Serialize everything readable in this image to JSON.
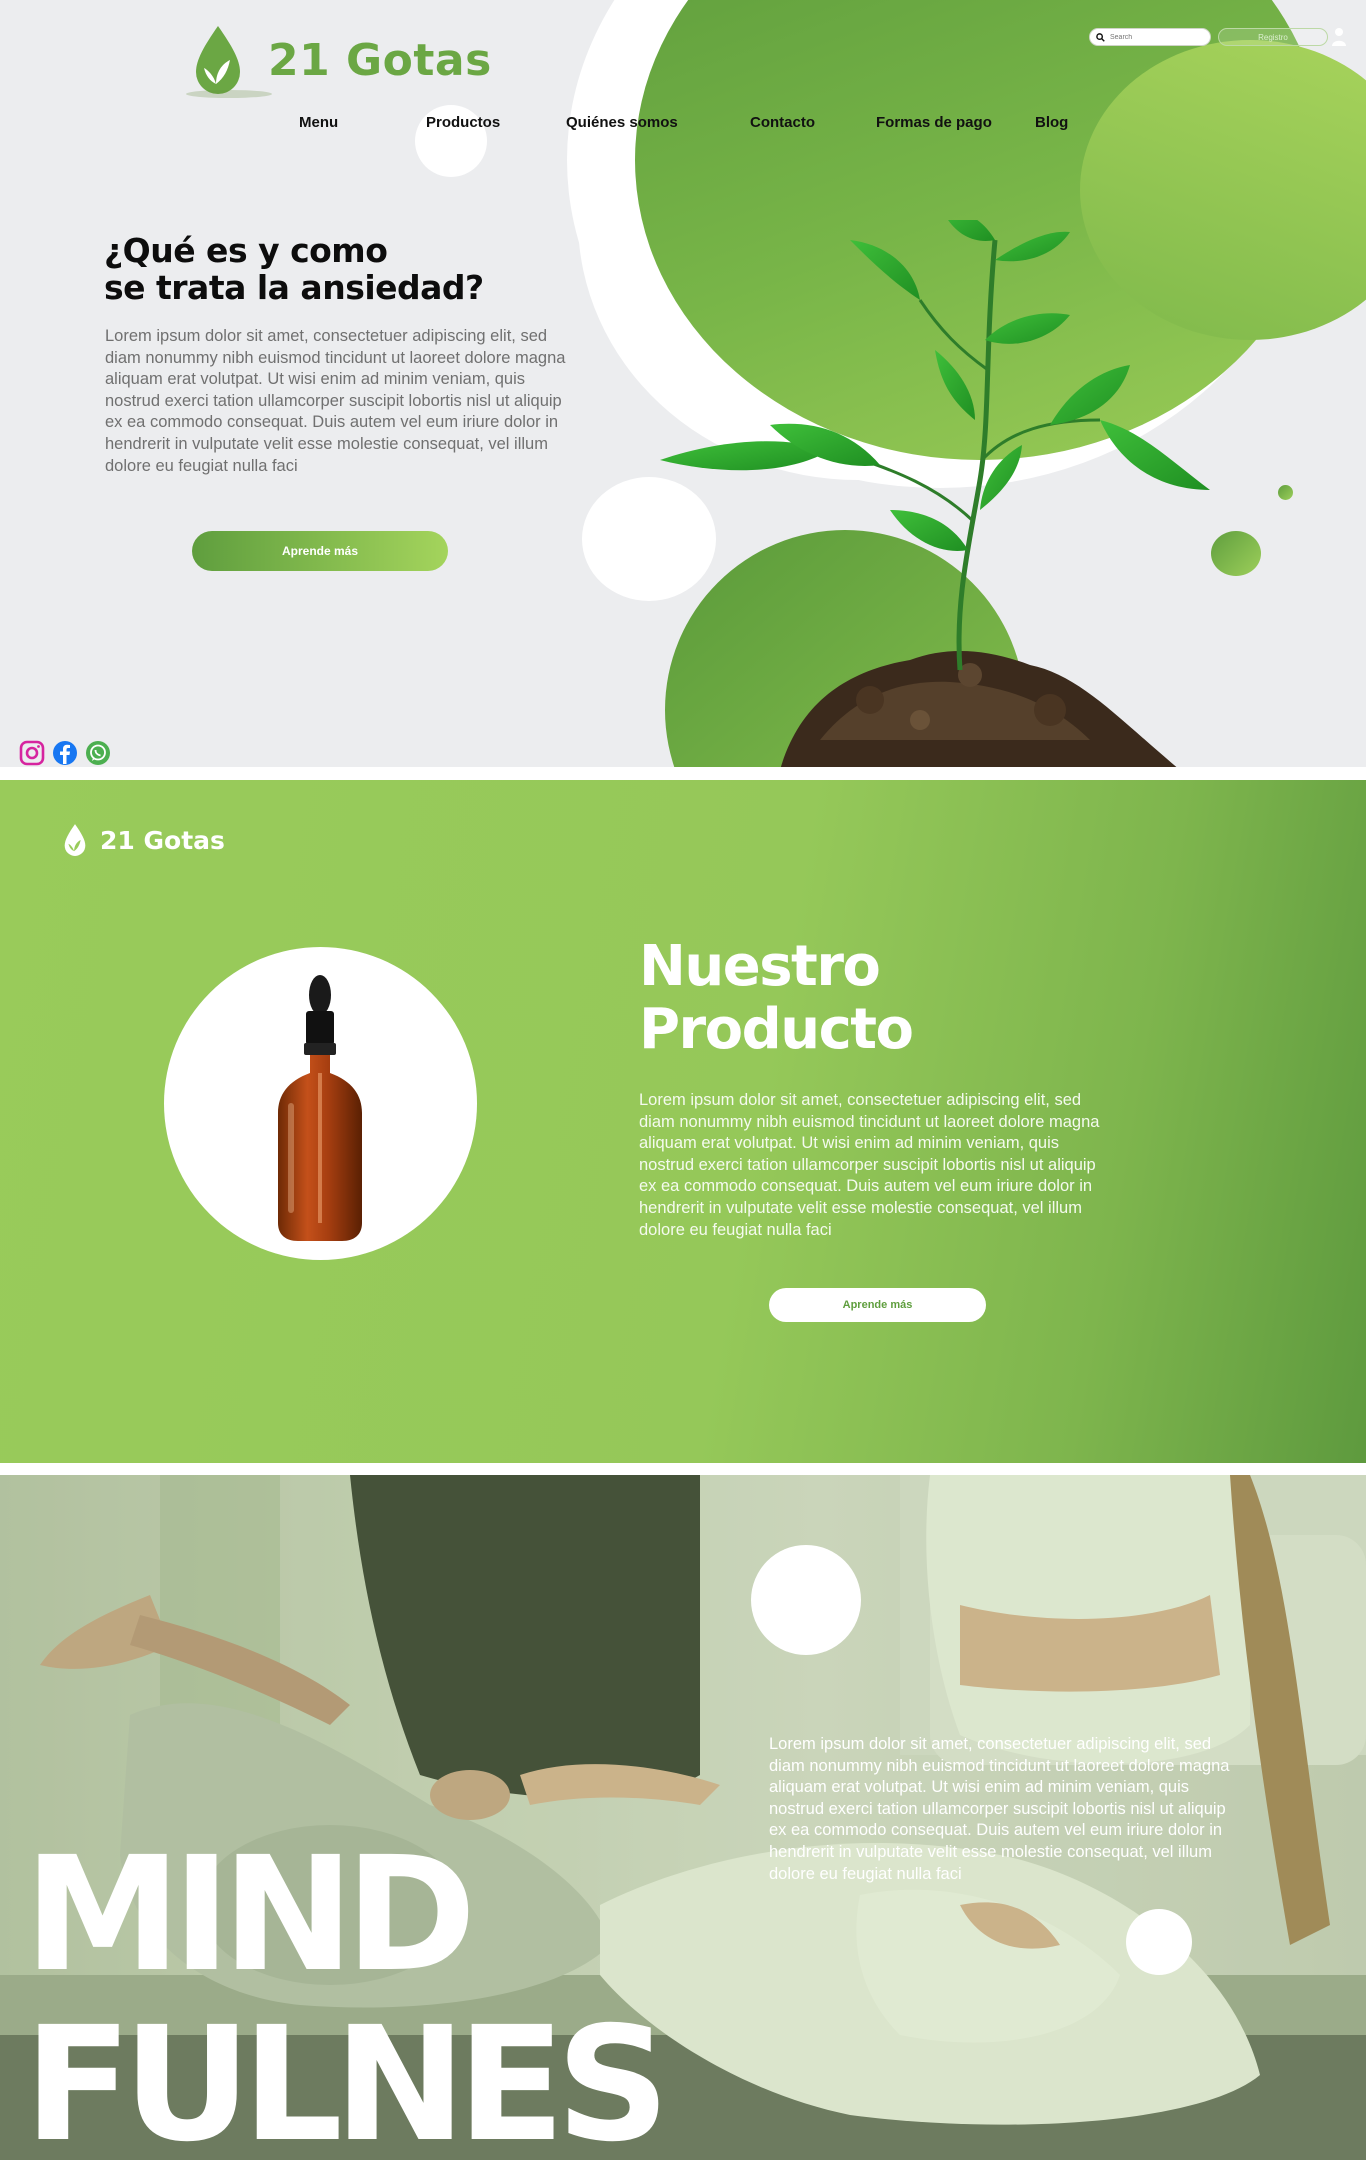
{
  "brand": {
    "name": "21 Gotas",
    "green": "#6ba744",
    "light_green": "#99cb5a",
    "dark_green": "#5e9a3e"
  },
  "header": {
    "search_placeholder": "Search",
    "registro_label": "Registro",
    "nav": [
      {
        "label": "Menu"
      },
      {
        "label": "Productos"
      },
      {
        "label": "Quiénes somos"
      },
      {
        "label": "Contacto"
      },
      {
        "label": "Formas de pago"
      },
      {
        "label": "Blog"
      }
    ]
  },
  "hero": {
    "title_line1": "¿Qué es y como",
    "title_line2": "se trata la ansiedad?",
    "body": "Lorem ipsum dolor sit amet, consectetuer adipiscing elit, sed diam nonummy nibh euismod tincidunt ut laoreet dolore magna aliquam erat volutpat. Ut wisi enim ad minim veniam, quis nostrud exerci tation ullamcorper suscipit lobortis nisl ut aliquip ex ea commodo consequat. Duis autem vel eum iriure dolor in hendrerit in vulputate velit esse molestie consequat, vel illum dolore eu feugiat nulla faci",
    "button_label": "Aprende más"
  },
  "social": [
    {
      "icon": "instagram-icon",
      "color": "#d6249f"
    },
    {
      "icon": "facebook-icon",
      "color": "#1877f2"
    },
    {
      "icon": "whatsapp-icon",
      "color": "#4caf50"
    }
  ],
  "product": {
    "title_line1": "Nuestro",
    "title_line2": "Producto",
    "body": "Lorem ipsum dolor sit amet, consectetuer adipiscing elit, sed diam nonummy nibh euismod tincidunt ut laoreet dolore magna aliquam erat volutpat. Ut wisi enim ad minim veniam, quis nostrud exerci tation ullamcorper suscipit lobortis nisl ut aliquip ex ea commodo consequat. Duis autem vel eum iriure dolor in hendrerit in vulputate velit esse molestie consequat, vel illum dolore eu feugiat nulla faci",
    "button_label": "Aprende más"
  },
  "mindfulness": {
    "body": "Lorem ipsum dolor sit amet, consectetuer adipiscing elit, sed diam nonummy nibh euismod tincidunt ut laoreet dolore magna aliquam erat volutpat. Ut wisi enim ad minim veniam, quis nostrud exerci tation ullamcorper suscipit lobortis nisl ut aliquip ex ea commodo consequat. Duis autem vel eum iriure dolor in hendrerit in vulputate velit esse molestie consequat, vel illum dolore eu feugiat nulla faci",
    "word1": "MIND",
    "word2": "FULNES"
  }
}
